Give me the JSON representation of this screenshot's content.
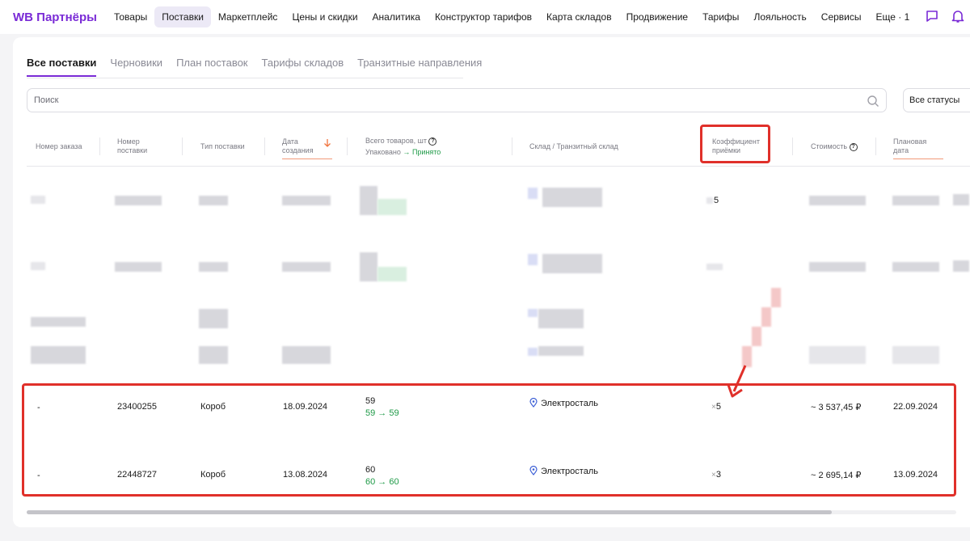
{
  "header": {
    "logo": "WB Партнёры",
    "nav": [
      "Товары",
      "Поставки",
      "Маркетплейс",
      "Цены и скидки",
      "Аналитика",
      "Конструктор тарифов",
      "Карта складов",
      "Продвижение",
      "Тарифы",
      "Лояльность",
      "Сервисы",
      "Еще · 1"
    ],
    "active_nav": "Поставки"
  },
  "tabs": [
    "Все поставки",
    "Черновики",
    "План поставок",
    "Тарифы складов",
    "Транзитные направления"
  ],
  "search": {
    "placeholder": "Поиск"
  },
  "status_filter": {
    "value": "Все статусы"
  },
  "table": {
    "headers": {
      "order": "Номер заказа",
      "supply": [
        "Номер",
        "поставки"
      ],
      "type": "Тип поставки",
      "created": [
        "Дата",
        "создания"
      ],
      "goods": "Всего товаров, шт",
      "goods_packed": "Упаковано",
      "goods_accepted": "Принято",
      "warehouse": "Склад / Транзитный склад",
      "coef": [
        "Коэффициент",
        "приёмки"
      ],
      "cost": "Стоимость",
      "planned": [
        "Плановая",
        "дата"
      ]
    },
    "blurred_rows": [
      {
        "coef": "5"
      },
      {
        "coef": ""
      }
    ],
    "rows": [
      {
        "order": "-",
        "supply": "23400255",
        "type": "Короб",
        "created": "18.09.2024",
        "total": "59",
        "packed": "59",
        "accepted": "59",
        "warehouse": "Электросталь",
        "coef_prefix": "×",
        "coef": "5",
        "cost": "~ 3 537,45 ₽",
        "planned": "22.09.2024"
      },
      {
        "order": "-",
        "supply": "22448727",
        "type": "Короб",
        "created": "13.08.2024",
        "total": "60",
        "packed": "60",
        "accepted": "60",
        "warehouse": "Электросталь",
        "coef_prefix": "×",
        "coef": "3",
        "cost": "~ 2 695,14 ₽",
        "planned": "13.09.2024"
      }
    ]
  },
  "colors": {
    "brand": "#7a2bd6",
    "accent_green": "#1f9a48",
    "highlight_red": "#e0302a"
  }
}
